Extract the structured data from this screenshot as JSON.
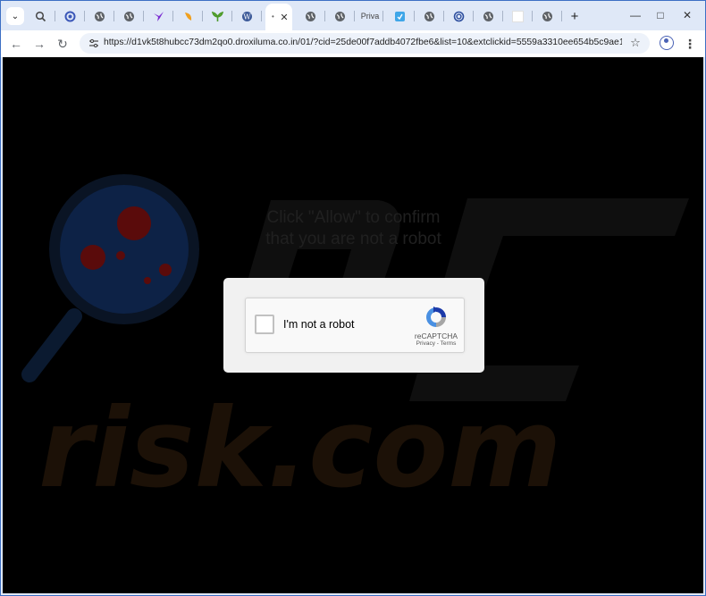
{
  "browser": {
    "tabs": [
      {
        "icon": "magnifier-tab-icon",
        "text": ""
      },
      {
        "icon": "c-tab-icon",
        "text": ""
      },
      {
        "icon": "globe-icon",
        "text": ""
      },
      {
        "icon": "globe-icon",
        "text": ""
      },
      {
        "icon": "purple-bird-icon",
        "text": ""
      },
      {
        "icon": "orange-leaf-icon",
        "text": ""
      },
      {
        "icon": "green-plant-icon",
        "text": ""
      },
      {
        "icon": "wordpress-icon",
        "text": ""
      },
      {
        "icon": "active-tab-icon",
        "text": "",
        "active": true
      },
      {
        "icon": "globe-icon",
        "text": ""
      },
      {
        "icon": "globe-icon",
        "text": ""
      },
      {
        "icon": "",
        "text": "Priva"
      },
      {
        "icon": "blue-square-icon",
        "text": ""
      },
      {
        "icon": "globe-icon",
        "text": ""
      },
      {
        "icon": "spiral-icon",
        "text": ""
      },
      {
        "icon": "globe-icon",
        "text": ""
      },
      {
        "icon": "white-square-icon",
        "text": ""
      },
      {
        "icon": "globe-icon",
        "text": ""
      }
    ],
    "url": "https://d1vk5t8hubcc73dm2qo0.droxiluma.co.in/01/?cid=25de00f7addb4072fbe6&list=10&extclickid=5559a3310ee654b5c9ae19...",
    "colors": {
      "tabstrip": "#dfe8f7",
      "omnibox": "#edf2fa",
      "page_background": "#000000"
    }
  },
  "page": {
    "prompt_line1": "Click \"Allow\" to confirm",
    "prompt_line2": "that you are not a robot",
    "captcha": {
      "label": "I'm not a robot",
      "brand": "reCAPTCHA",
      "links": "Privacy - Terms"
    }
  },
  "watermark": {
    "text": "risk.com",
    "icon": "magnifier-virus-icon"
  }
}
